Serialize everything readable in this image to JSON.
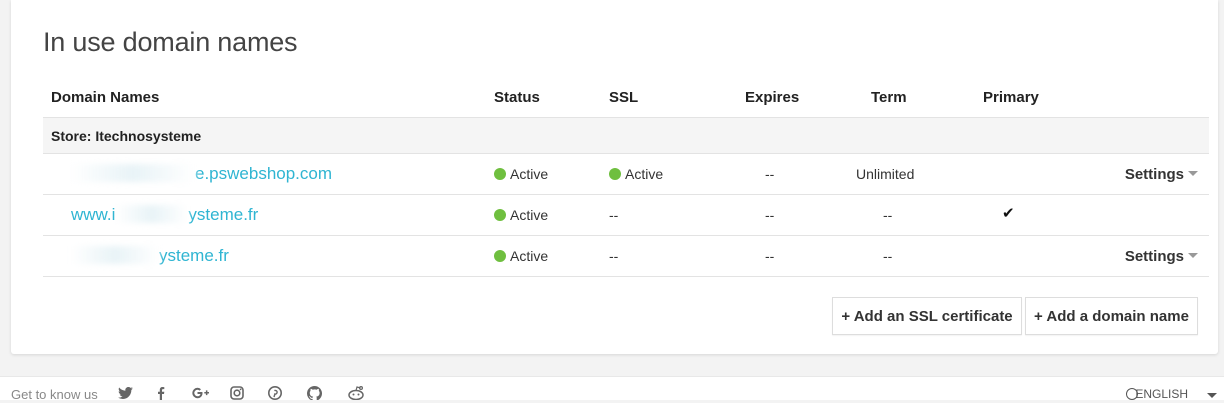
{
  "title": "In use domain names",
  "table": {
    "headers": [
      "Domain Names",
      "Status",
      "SSL",
      "Expires",
      "Term",
      "Primary"
    ],
    "group": "Store: Itechnosysteme",
    "rows": [
      {
        "domain": "e.pswebshop.com",
        "status": "Active",
        "ssl": "Active",
        "expires": "--",
        "term": "Unlimited",
        "primary": "",
        "settings": "Settings"
      },
      {
        "domain_prefix": "www.i",
        "domain": "ysteme.fr",
        "status": "Active",
        "ssl": "--",
        "expires": "--",
        "term": "--",
        "primary": "✔",
        "settings": ""
      },
      {
        "domain": "ysteme.fr",
        "status": "Active",
        "ssl": "--",
        "expires": "--",
        "term": "--",
        "primary": "",
        "settings": "Settings"
      }
    ]
  },
  "actions": {
    "add_ssl": "+ Add an SSL certificate",
    "add_domain": "+ Add a domain name"
  },
  "footer": {
    "label": "Get to know us",
    "social_icons": [
      "twitter-icon",
      "facebook-icon",
      "google-plus-icon",
      "instagram-icon",
      "pinterest-icon",
      "github-icon",
      "reddit-icon"
    ],
    "language": "ENGLISH"
  },
  "colors": {
    "link": "#2fb5d2",
    "status_active": "#6fbf3f"
  }
}
